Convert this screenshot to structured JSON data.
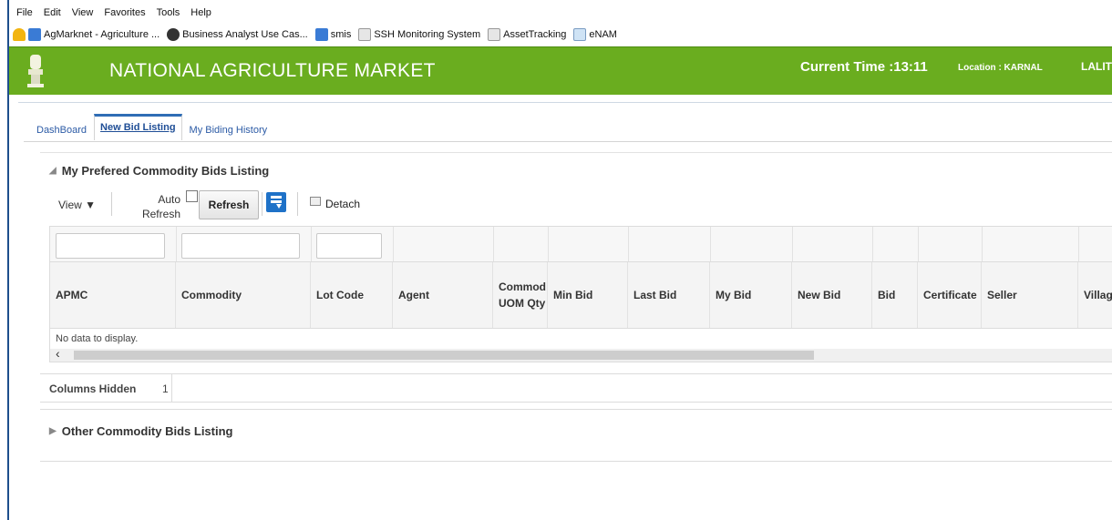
{
  "menu": [
    "File",
    "Edit",
    "View",
    "Favorites",
    "Tools",
    "Help"
  ],
  "favorites": [
    {
      "label": "AgMarknet - Agriculture ...",
      "icon": "ie-page-icon"
    },
    {
      "label": "Business Analyst Use Cas...",
      "icon": "ba-icon"
    },
    {
      "label": "smis",
      "icon": "ie-page-icon"
    },
    {
      "label": "SSH Monitoring System",
      "icon": "chart-icon"
    },
    {
      "label": "AssetTracking",
      "icon": "chart-icon"
    },
    {
      "label": "eNAM",
      "icon": "grid-icon"
    }
  ],
  "header": {
    "title": "NATIONAL AGRICULTURE MARKET",
    "current_time": "Current Time :13:11",
    "location": "Location : KARNAL",
    "user": "LALIT",
    "brand_color": "#6aad1f"
  },
  "tabs": [
    "DashBoard",
    "New Bid Listing",
    "My Biding History"
  ],
  "active_tab": "New Bid Listing",
  "section1": {
    "title": "My Prefered Commodity Bids Listing",
    "toolbar": {
      "view_label": "View ▼",
      "auto_label": "Auto",
      "refresh_word": "Refresh",
      "refresh_button": "Refresh",
      "detach_label": "Detach"
    },
    "columns": [
      {
        "label": "APMC",
        "w": 138
      },
      {
        "label": "Commodity",
        "w": 148
      },
      {
        "label": "Lot Code",
        "w": 90
      },
      {
        "label": "Agent",
        "w": 110
      },
      {
        "label": "Commod UOM Qty",
        "w": 60
      },
      {
        "label": "Min Bid",
        "w": 88
      },
      {
        "label": "Last Bid",
        "w": 90
      },
      {
        "label": "My Bid",
        "w": 90
      },
      {
        "label": "New Bid",
        "w": 88
      },
      {
        "label": "Bid",
        "w": 50
      },
      {
        "label": "Certificate",
        "w": 70
      },
      {
        "label": "Seller",
        "w": 106
      },
      {
        "label": "Village",
        "w": 40
      }
    ],
    "empty_text": "No data to display.",
    "columns_hidden_label": "Columns Hidden",
    "columns_hidden_count": "1"
  },
  "section2": {
    "title": "Other Commodity Bids Listing"
  }
}
